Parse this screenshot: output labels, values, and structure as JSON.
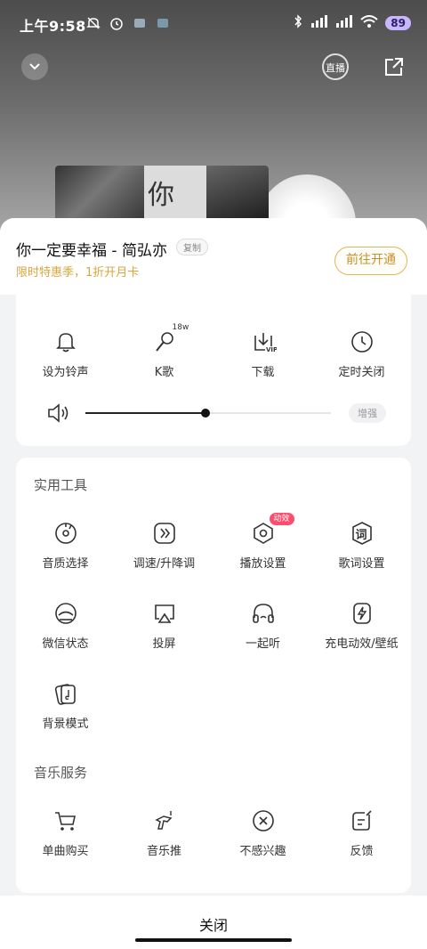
{
  "status_bar": {
    "time": "上午9:58",
    "battery": "89",
    "network_labels": [
      "HD",
      "HD"
    ]
  },
  "player": {
    "live_label": "直播",
    "album_text": "你"
  },
  "sheet": {
    "song_title": "你一定要幸福 - 简弘亦",
    "copy_label": "复制",
    "promo_text": "限时特惠季，1折开月卡",
    "open_button": "前往开通",
    "top_row_partial": [
      "",
      "",
      "",
      ""
    ],
    "main_actions": [
      {
        "label": "设为铃声",
        "icon": "bell-icon"
      },
      {
        "label": "K歌",
        "icon": "karaoke-mic-icon",
        "sup": "18w"
      },
      {
        "label": "下载",
        "icon": "download-vip-icon"
      },
      {
        "label": "定时关闭",
        "icon": "clock-icon"
      }
    ],
    "volume": {
      "level": 0.49,
      "boost_label": "增强"
    },
    "tools_title": "实用工具",
    "tools": [
      {
        "label": "音质选择",
        "icon": "sound-quality-icon"
      },
      {
        "label": "调速/升降调",
        "icon": "speed-icon"
      },
      {
        "label": "播放设置",
        "icon": "play-settings-icon",
        "badge": "动效"
      },
      {
        "label": "歌词设置",
        "icon": "lyrics-icon",
        "glyph": "词"
      },
      {
        "label": "微信状态",
        "icon": "wechat-status-icon"
      },
      {
        "label": "投屏",
        "icon": "cast-icon"
      },
      {
        "label": "一起听",
        "icon": "listen-together-icon"
      },
      {
        "label": "充电动效/壁纸",
        "icon": "charging-icon"
      },
      {
        "label": "背景模式",
        "icon": "background-mode-icon"
      }
    ],
    "services_title": "音乐服务",
    "services": [
      {
        "label": "单曲购买",
        "icon": "cart-icon"
      },
      {
        "label": "音乐推",
        "icon": "music-push-icon"
      },
      {
        "label": "不感兴趣",
        "icon": "not-interested-icon"
      },
      {
        "label": "反馈",
        "icon": "feedback-icon"
      }
    ],
    "close_label": "关闭"
  }
}
